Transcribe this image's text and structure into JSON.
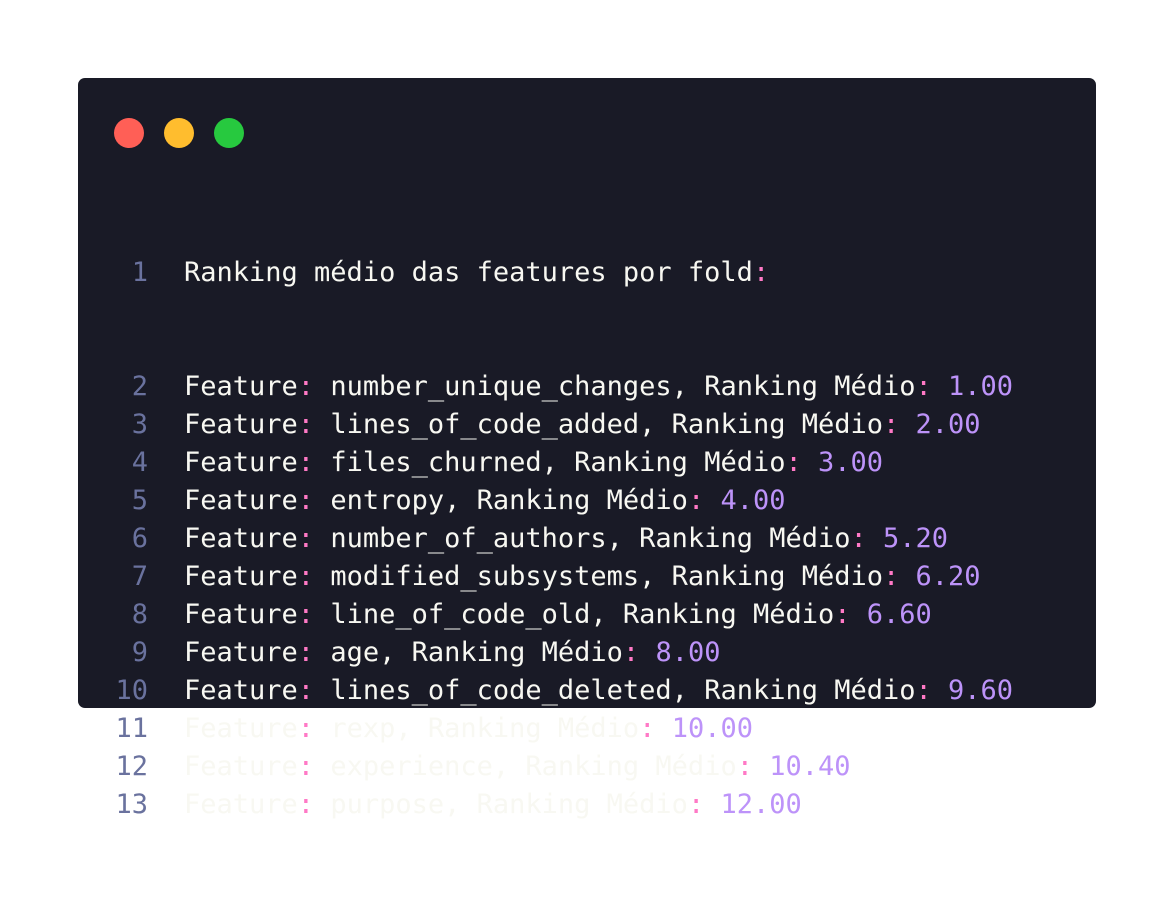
{
  "window": {
    "traffic_lights": [
      {
        "name": "close",
        "color": "#ff5f56"
      },
      {
        "name": "minimize",
        "color": "#ffbd2e"
      },
      {
        "name": "maximize",
        "color": "#27c93f"
      }
    ]
  },
  "colors": {
    "background": "#191a26",
    "text": "#f8f8f2",
    "line_number": "#6a729e",
    "punctuation": "#ff79c6",
    "number": "#bd93f9"
  },
  "code": {
    "header": {
      "line_number": "1",
      "text": "Ranking médio das features por fold",
      "colon": ":"
    },
    "rows": [
      {
        "ln": "2",
        "label": "Feature",
        "colon": ":",
        "feature": " number_unique_changes, Ranking Médio",
        "colon2": ":",
        "value": " 1.00"
      },
      {
        "ln": "3",
        "label": "Feature",
        "colon": ":",
        "feature": " lines_of_code_added, Ranking Médio",
        "colon2": ":",
        "value": " 2.00"
      },
      {
        "ln": "4",
        "label": "Feature",
        "colon": ":",
        "feature": " files_churned, Ranking Médio",
        "colon2": ":",
        "value": " 3.00"
      },
      {
        "ln": "5",
        "label": "Feature",
        "colon": ":",
        "feature": " entropy, Ranking Médio",
        "colon2": ":",
        "value": " 4.00"
      },
      {
        "ln": "6",
        "label": "Feature",
        "colon": ":",
        "feature": " number_of_authors, Ranking Médio",
        "colon2": ":",
        "value": " 5.20"
      },
      {
        "ln": "7",
        "label": "Feature",
        "colon": ":",
        "feature": " modified_subsystems, Ranking Médio",
        "colon2": ":",
        "value": " 6.20"
      },
      {
        "ln": "8",
        "label": "Feature",
        "colon": ":",
        "feature": " line_of_code_old, Ranking Médio",
        "colon2": ":",
        "value": " 6.60"
      },
      {
        "ln": "9",
        "label": "Feature",
        "colon": ":",
        "feature": " age, Ranking Médio",
        "colon2": ":",
        "value": " 8.00"
      },
      {
        "ln": "10",
        "label": "Feature",
        "colon": ":",
        "feature": " lines_of_code_deleted, Ranking Médio",
        "colon2": ":",
        "value": " 9.60"
      },
      {
        "ln": "11",
        "label": "Feature",
        "colon": ":",
        "feature": " rexp, Ranking Médio",
        "colon2": ":",
        "value": " 10.00"
      },
      {
        "ln": "12",
        "label": "Feature",
        "colon": ":",
        "feature": " experience, Ranking Médio",
        "colon2": ":",
        "value": " 10.40"
      },
      {
        "ln": "13",
        "label": "Feature",
        "colon": ":",
        "feature": " purpose, Ranking Médio",
        "colon2": ":",
        "value": " 12.00"
      }
    ]
  }
}
